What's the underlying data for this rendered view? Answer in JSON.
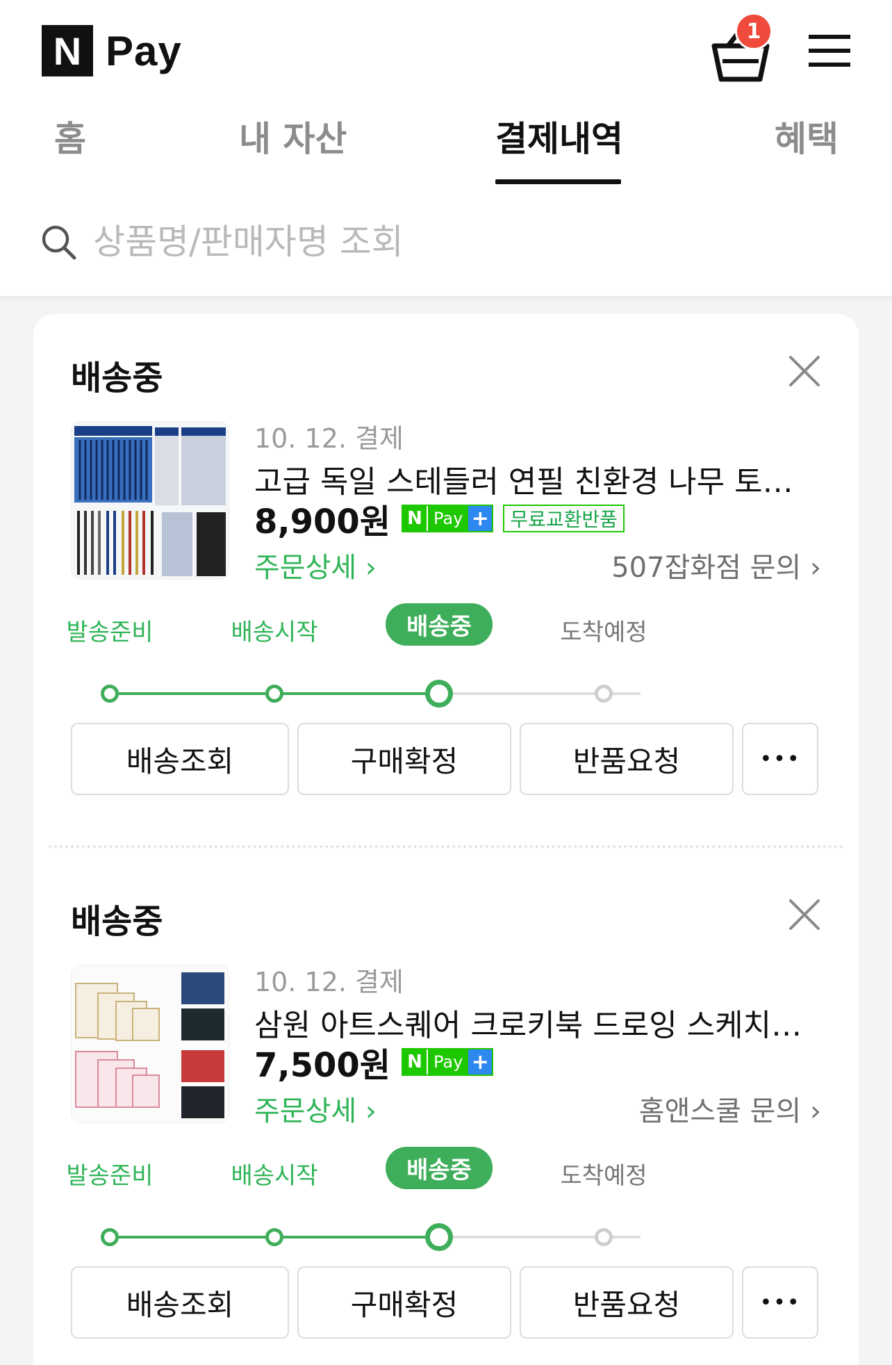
{
  "header": {
    "logo_letter": "N",
    "logo_text": "Pay",
    "cart_count": "1"
  },
  "tabs": [
    {
      "label": "홈",
      "active": false
    },
    {
      "label": "내 자산",
      "active": false
    },
    {
      "label": "결제내역",
      "active": true
    },
    {
      "label": "혜택",
      "active": false
    }
  ],
  "search": {
    "placeholder": "상품명/판매자명 조회"
  },
  "orders": [
    {
      "status": "배송중",
      "date": "10. 12. 결제",
      "title": "고급 독일 스테들러 연필 친환경 나무 토익 미...",
      "price": "8,900원",
      "npay_n": "N",
      "npay_text": "Pay",
      "npay_plus": "+",
      "free_return": "무료교환반품",
      "detail_link": "주문상세 ›",
      "seller_link": "507잡화점 문의 ›",
      "steps": [
        "발송준비",
        "배송시작",
        "배송중",
        "도착예정"
      ],
      "current_step": 2,
      "actions": [
        "배송조회",
        "구매확정",
        "반품요청",
        "•••"
      ]
    },
    {
      "status": "배송중",
      "date": "10. 12. 결제",
      "title": "삼원 아트스퀘어 크로키북 드로잉 스케치북 노...",
      "price": "7,500원",
      "npay_n": "N",
      "npay_text": "Pay",
      "npay_plus": "+",
      "detail_link": "주문상세 ›",
      "seller_link": "홈앤스쿨 문의 ›",
      "steps": [
        "발송준비",
        "배송시작",
        "배송중",
        "도착예정"
      ],
      "current_step": 2,
      "actions": [
        "배송조회",
        "구매확정",
        "반품요청",
        "•••"
      ]
    }
  ],
  "colors": {
    "accent_green": "#3fae5a",
    "link_green": "#2fb457",
    "npay_green": "#1ec800",
    "badge_red": "#f04a3c"
  }
}
